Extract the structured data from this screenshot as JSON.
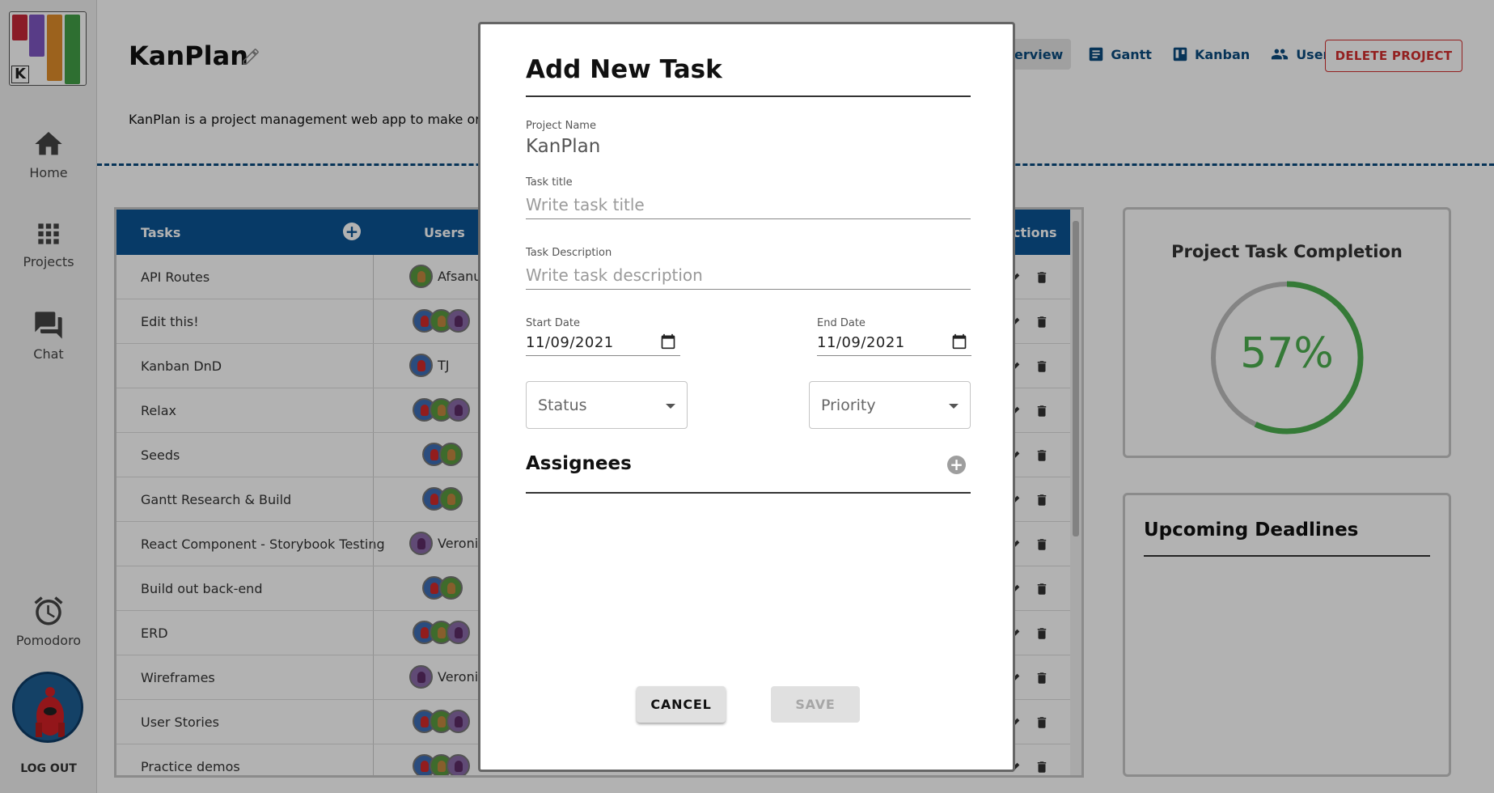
{
  "sidebar": {
    "logo_letter": "K",
    "items": [
      {
        "label": "Home",
        "icon": "home-icon"
      },
      {
        "label": "Projects",
        "icon": "grid-icon"
      },
      {
        "label": "Chat",
        "icon": "chat-icon"
      },
      {
        "label": "Pomodoro",
        "icon": "alarm-clock-icon"
      }
    ],
    "logout_label": "LOG OUT"
  },
  "project": {
    "title": "KanPlan",
    "description": "KanPlan is a project management web app to make organizi"
  },
  "topnav": {
    "items": [
      {
        "label": "Overview",
        "icon": "overview-icon"
      },
      {
        "label": "Gantt",
        "icon": "gantt-icon"
      },
      {
        "label": "Kanban",
        "icon": "kanban-icon"
      },
      {
        "label": "Users",
        "icon": "users-icon"
      }
    ],
    "delete_label": "DELETE PROJECT"
  },
  "table": {
    "headers": {
      "tasks": "Tasks",
      "users": "Users",
      "actions": "ctions"
    },
    "rows": [
      {
        "name": "API Routes",
        "user_name": "Afsanul"
      },
      {
        "name": "Edit this!",
        "user_name": ""
      },
      {
        "name": "Kanban DnD",
        "user_name": "TJ"
      },
      {
        "name": "Relax",
        "user_name": ""
      },
      {
        "name": "Seeds",
        "user_name": ""
      },
      {
        "name": "Gantt Research & Build",
        "user_name": ""
      },
      {
        "name": "React Component - Storybook Testing",
        "user_name": "Veronica"
      },
      {
        "name": "Build out back-end",
        "user_name": ""
      },
      {
        "name": "ERD",
        "user_name": ""
      },
      {
        "name": "Wireframes",
        "user_name": "Veronica"
      },
      {
        "name": "User Stories",
        "user_name": ""
      },
      {
        "name": "Practice demos",
        "user_name": ""
      }
    ]
  },
  "completion": {
    "title": "Project Task Completion",
    "percent_label": "57%",
    "percent": 57,
    "color": "#4caf50"
  },
  "deadlines": {
    "title": "Upcoming Deadlines"
  },
  "modal": {
    "title": "Add New Task",
    "project_name_label": "Project Name",
    "project_name_value": "KanPlan",
    "task_title_label": "Task title",
    "task_title_placeholder": "Write task title",
    "task_desc_label": "Task Description",
    "task_desc_placeholder": "Write task description",
    "start_date_label": "Start Date",
    "start_date_value": "11/09/2021",
    "end_date_label": "End Date",
    "end_date_value": "11/09/2021",
    "status_label": "Status",
    "priority_label": "Priority",
    "assignees_label": "Assignees",
    "cancel_label": "CANCEL",
    "save_label": "SAVE"
  },
  "colors": {
    "primary": "#0b5394",
    "danger": "#d32f2f",
    "success": "#4caf50"
  }
}
